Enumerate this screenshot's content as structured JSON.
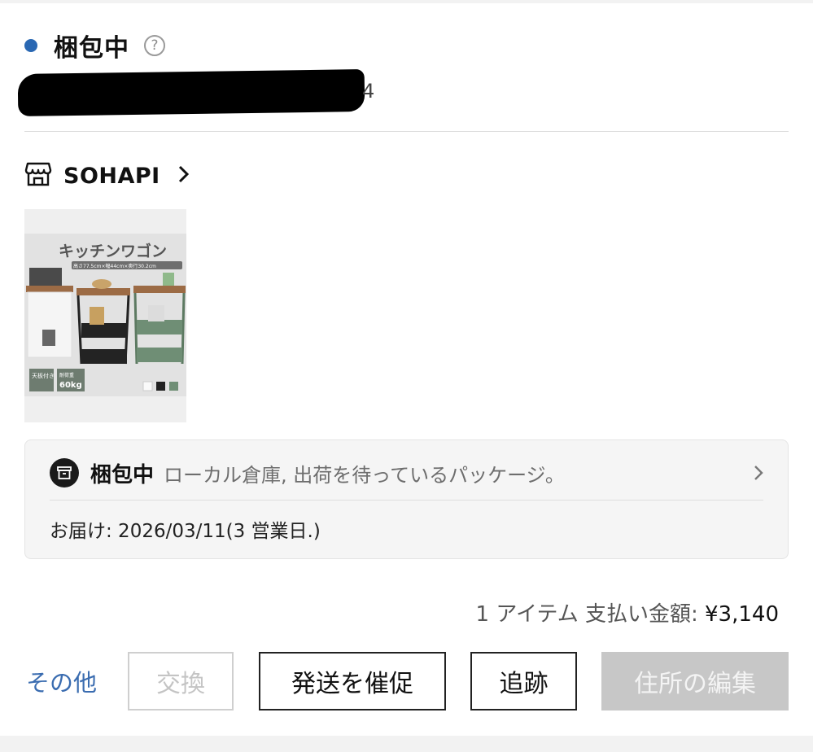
{
  "order": {
    "status_title": "梱包中",
    "help_glyph": "?",
    "id_tail": "4",
    "status_color": "#2a68b3"
  },
  "shop": {
    "name": "SOHAPI",
    "icon": "store-icon"
  },
  "product": {
    "image_title": "キッチンワゴン",
    "image_dims": "高さ77.5cm×幅44cm×奥行30.2cm",
    "badge_top": "天板付き",
    "badge_load_label": "耐荷重",
    "badge_load_value": "60kg"
  },
  "status_box": {
    "status": "梱包中",
    "description": "ローカル倉庫, 出荷を待っているパッケージ。",
    "delivery": "お届け: 2026/03/11(3 営業日.)"
  },
  "summary": {
    "items_label": "1 アイテム 支払い金額:",
    "amount": "¥3,140"
  },
  "actions": {
    "more": "その他",
    "exchange": "交換",
    "urge": "発送を催促",
    "track": "追跡",
    "edit_address": "住所の編集"
  }
}
